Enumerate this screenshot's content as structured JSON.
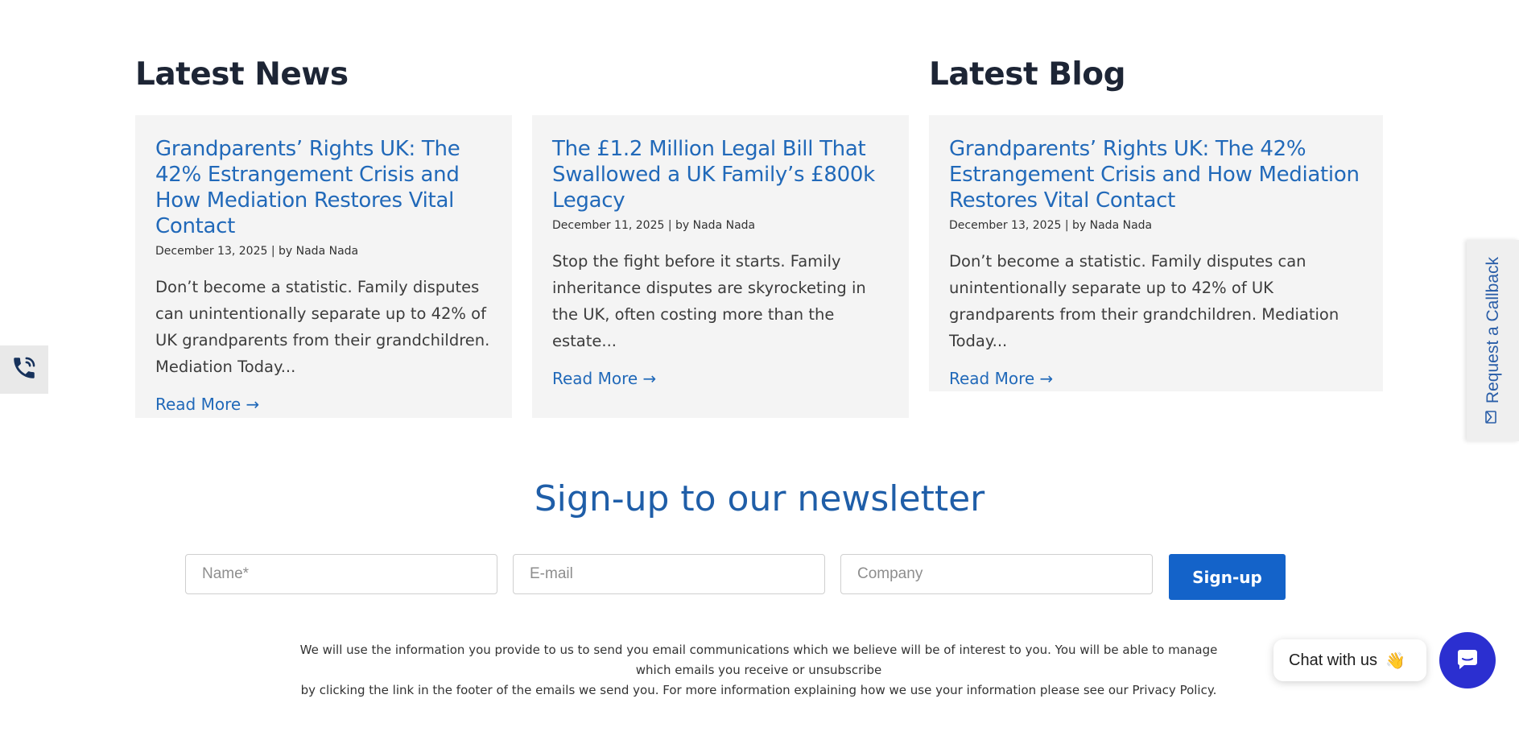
{
  "news": {
    "title": "Latest News",
    "cards": [
      {
        "title": "Grandparents’ Rights UK: The 42% Estrangement Crisis and How Mediation Restores Vital Contact",
        "meta": "December 13, 2025 | by Nada Nada",
        "excerpt": "Don’t become a statistic. Family disputes can unintentionally separate up to 42% of UK grandparents from their grandchildren. Mediation Today...",
        "link": "Read More →"
      },
      {
        "title": "The £1.2 Million Legal Bill That Swallowed a UK Family’s £800k Legacy",
        "meta": "December 11, 2025 | by Nada Nada",
        "excerpt": "Stop the fight before it starts. Family inheritance disputes are skyrocketing in the UK, often costing more than the estate...",
        "link": "Read More →"
      }
    ]
  },
  "blog": {
    "title": "Latest Blog",
    "cards": [
      {
        "title": "Grandparents’ Rights UK: The 42% Estrangement Crisis and How Mediation Restores Vital Contact",
        "meta": "December 13, 2025 | by Nada Nada",
        "excerpt": "Don’t become a statistic. Family disputes can unintentionally separate up to 42% of UK grandparents from their grandchildren. Mediation Today...",
        "link": "Read More →"
      }
    ]
  },
  "newsletter": {
    "heading": "Sign-up to our newsletter",
    "name_placeholder": "Name*",
    "email_placeholder": "E-mail",
    "company_placeholder": "Company",
    "button_label": "Sign-up",
    "disclaimer_line1": "We will use the information you provide to us to send you email communications which we believe will be of interest to you. You will be able to manage which emails you receive or unsubscribe",
    "disclaimer_line2": "by clicking the link in the footer of the emails we send you. For more information explaining how we use your information please see our Privacy Policy."
  },
  "callback": {
    "label": "Request a Callback",
    "icon": "envelope-icon"
  },
  "phone": {
    "icon": "phone-icon"
  },
  "chat": {
    "bubble_text": "Chat with us",
    "bubble_emoji": "👋",
    "button_icon": "chat-icon"
  },
  "colors": {
    "link_blue": "#2169b9",
    "heading_navy": "#1d2535",
    "newsletter_blue": "#1f5ea8",
    "button_blue": "#1463c9",
    "chat_purple": "#2b2fd0",
    "card_bg": "#f4f4f4"
  }
}
